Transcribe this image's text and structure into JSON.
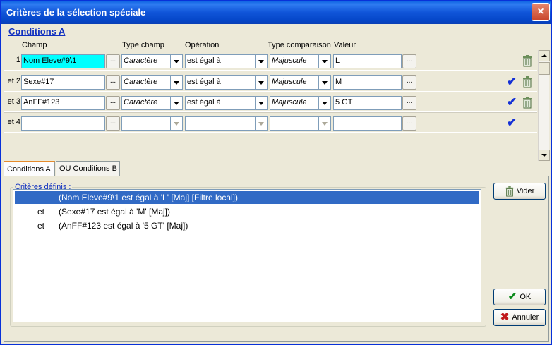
{
  "window": {
    "title": "Critères de la sélection spéciale",
    "close": "×"
  },
  "section_title": "Conditions A",
  "headers": {
    "champ": "Champ",
    "type_champ": "Type champ",
    "operation": "Opération",
    "type_comparaison": "Type comparaison",
    "valeur": "Valeur"
  },
  "rows": [
    {
      "num": "1",
      "champ": "Nom Eleve#9\\1",
      "type_champ": "Caractère",
      "operation": "est égal à",
      "type_comparaison": "Majuscule",
      "valeur": "L",
      "ellipsis": "..."
    },
    {
      "num": "et 2",
      "champ": "Sexe#17",
      "type_champ": "Caractère",
      "operation": "est égal à",
      "type_comparaison": "Majuscule",
      "valeur": "M",
      "ellipsis": "..."
    },
    {
      "num": "et 3",
      "champ": "AnFF#123",
      "type_champ": "Caractère",
      "operation": "est égal à",
      "type_comparaison": "Majuscule",
      "valeur": "5 GT",
      "ellipsis": "..."
    },
    {
      "num": "et 4",
      "champ": "",
      "type_champ": "",
      "operation": "",
      "type_comparaison": "",
      "valeur": "",
      "ellipsis": "..."
    }
  ],
  "tabs": [
    "Conditions A",
    "OU Conditions B"
  ],
  "criteres": {
    "legend": "Critères définis :",
    "items": [
      {
        "prefix": "",
        "text": "(Nom Eleve#9\\1 est égal à 'L' [Maj] [Filtre local])"
      },
      {
        "prefix": "et",
        "text": "(Sexe#17 est égal à 'M' [Maj])"
      },
      {
        "prefix": "et",
        "text": "(AnFF#123 est égal à '5 GT' [Maj])"
      }
    ]
  },
  "buttons": {
    "vider": "Vider",
    "ok": "OK",
    "annuler": "Annuler"
  },
  "colors": {
    "accent": "#1030c0",
    "selection": "#316ac5",
    "active_field": "#00ffff",
    "check": "#1430d6",
    "cancel": "#c0181a",
    "ok": "#0b8a1a"
  }
}
